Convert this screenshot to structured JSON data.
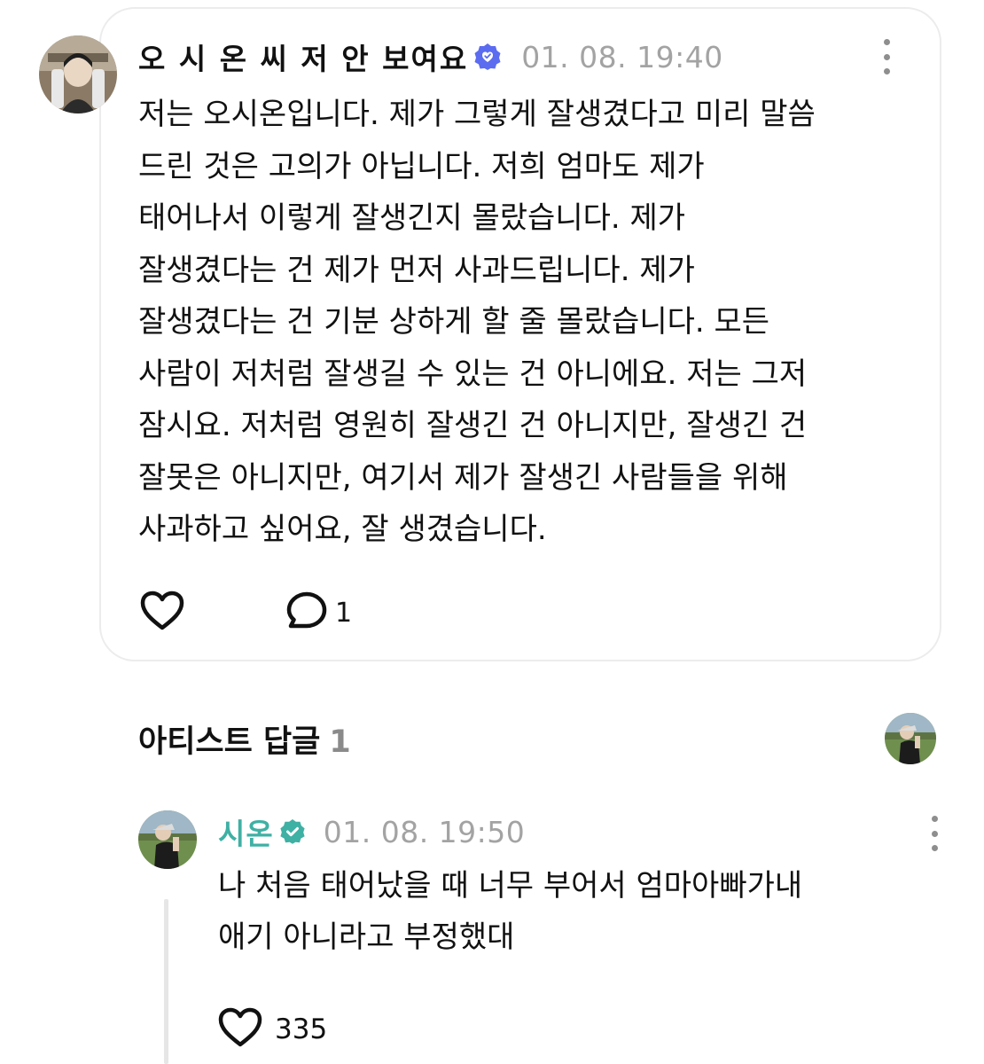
{
  "post": {
    "author": "오 시 온 씨 저 안 보여요",
    "timestamp": "01. 08. 19:40",
    "body_lines": [
      "저는 오시온입니다. 제가 그렇게 잘생겼다고 미리 말씀",
      "드린 것은 고의가 아닙니다. 저희 엄마도 제가",
      "태어나서 이렇게 잘생긴지 몰랐습니다. 제가",
      "잘생겼다는 건 제가 먼저 사과드립니다. 제가",
      "잘생겼다는 건 기분 상하게 할 줄 몰랐습니다. 모든",
      "사람이 저처럼 잘생길 수 있는 건 아니에요. 저는 그저",
      "잠시요. 저처럼 영원히 잘생긴 건 아니지만, 잘생긴 건",
      "잘못은 아니지만, 여기서 제가 잘생긴 사람들을 위해",
      "사과하고 싶어요, 잘 생겼습니다."
    ],
    "comment_count": "1",
    "icons": {
      "avatar": "user-avatar",
      "badge": "verified-heart-badge-icon",
      "like": "heart-icon",
      "comment": "comment-bubble-icon",
      "more": "more-vertical-icon"
    }
  },
  "artist_reply": {
    "section_title": "아티스트 답글",
    "section_count": "1",
    "author": "시온",
    "timestamp": "01. 08. 19:50",
    "body_lines": [
      "나 처음 태어났을 때 너무 부어서 엄마아빠가내",
      "애기 아니라고 부정했대"
    ],
    "like_count": "335",
    "icons": {
      "badge": "artist-verified-badge-icon",
      "like": "heart-icon",
      "more": "more-vertical-icon"
    }
  },
  "colors": {
    "artist_name": "#3fb0a4",
    "verified_blue": "#5b6cf0",
    "timestamp": "#a3a3a3",
    "card_border": "#ececec"
  }
}
